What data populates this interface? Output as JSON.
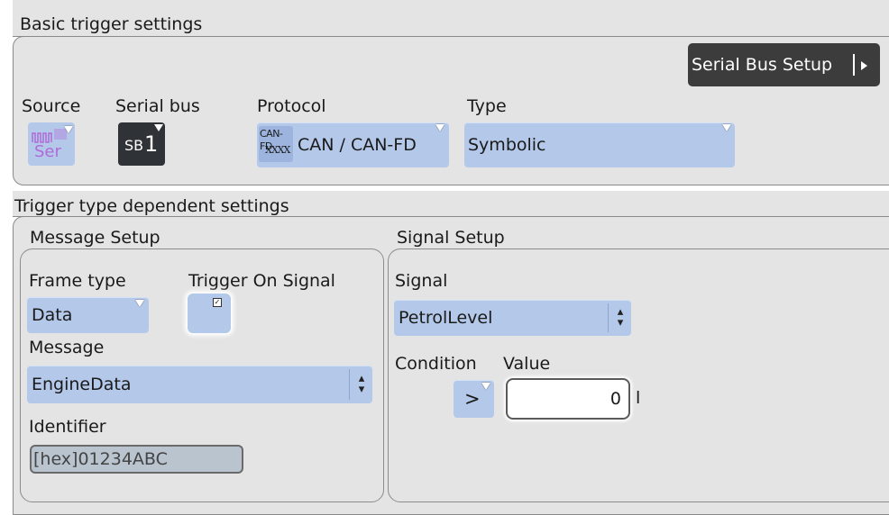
{
  "basic": {
    "title": "Basic trigger settings",
    "serial_bus_setup_label": "Serial Bus Setup",
    "source": {
      "label": "Source",
      "icon_top": "⎍⎍⎍",
      "icon_bottom": "Ser"
    },
    "serial_bus": {
      "label": "Serial bus",
      "value_prefix": "SB",
      "value_num": "1"
    },
    "protocol": {
      "label": "Protocol",
      "icon_top": "CAN-FD",
      "icon_bottom": "XXXX",
      "value": "CAN / CAN-FD"
    },
    "type": {
      "label": "Type",
      "value": "Symbolic"
    }
  },
  "dependent": {
    "title": "Trigger type dependent settings",
    "message_setup": {
      "title": "Message Setup",
      "frame_type_label": "Frame type",
      "frame_type_value": "Data",
      "trigger_on_signal_label": "Trigger On Signal",
      "message_label": "Message",
      "message_value": "EngineData",
      "identifier_label": "Identifier",
      "identifier_value": "[hex]01234ABC"
    },
    "signal_setup": {
      "title": "Signal Setup",
      "signal_label": "Signal",
      "signal_value": "PetrolLevel",
      "condition_label": "Condition",
      "condition_value": ">",
      "value_label": "Value",
      "value_value": "0",
      "value_unit": "l"
    }
  },
  "colors": {
    "accent_blue": "#b4c8ea",
    "panel_grey": "#e4e4e4",
    "dark_button": "#3c3c3c",
    "source_icon_purple": "#b06ad6"
  }
}
